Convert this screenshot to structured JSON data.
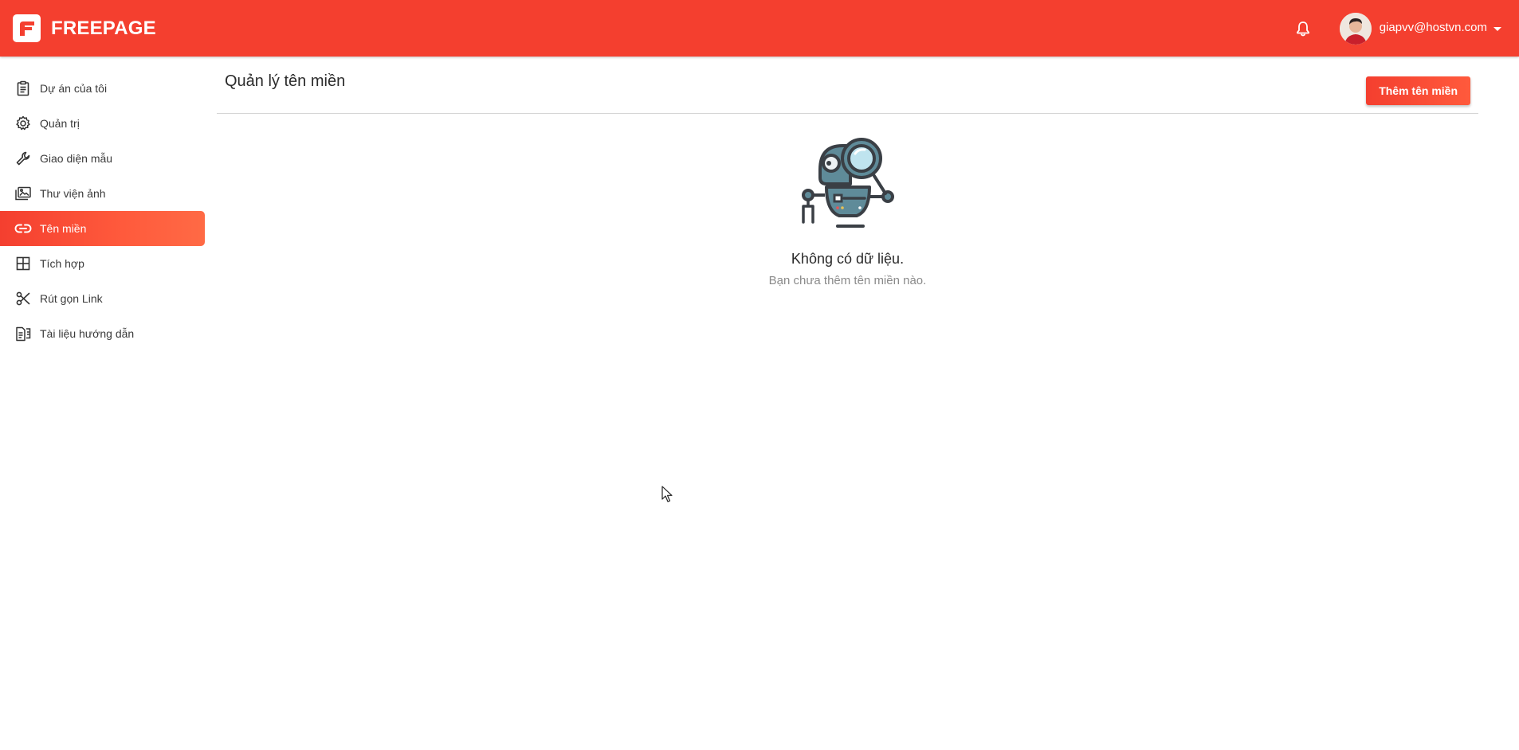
{
  "header": {
    "brand_name": "FREEPAGE",
    "user_email": "giapvv@hostvn.com"
  },
  "sidebar": {
    "items": [
      {
        "label": "Dự án của tôi",
        "icon": "clipboard-icon"
      },
      {
        "label": "Quản trị",
        "icon": "gear-icon"
      },
      {
        "label": "Giao diện mẫu",
        "icon": "wrench-icon"
      },
      {
        "label": "Thư viện ảnh",
        "icon": "image-library-icon"
      },
      {
        "label": "Tên miền",
        "icon": "link-icon",
        "active": true
      },
      {
        "label": "Tích hợp",
        "icon": "grid-icon"
      },
      {
        "label": "Rút gọn Link",
        "icon": "scissors-icon"
      },
      {
        "label": "Tài liệu hướng dẫn",
        "icon": "document-icon"
      }
    ]
  },
  "main": {
    "title": "Quản lý tên miền",
    "add_button_label": "Thêm tên miền",
    "empty_title": "Không có dữ liệu.",
    "empty_subtitle": "Bạn chưa thêm tên miền nào."
  },
  "colors": {
    "brand": "#f43f2f",
    "accent_gradient_end": "#ff6a45"
  }
}
